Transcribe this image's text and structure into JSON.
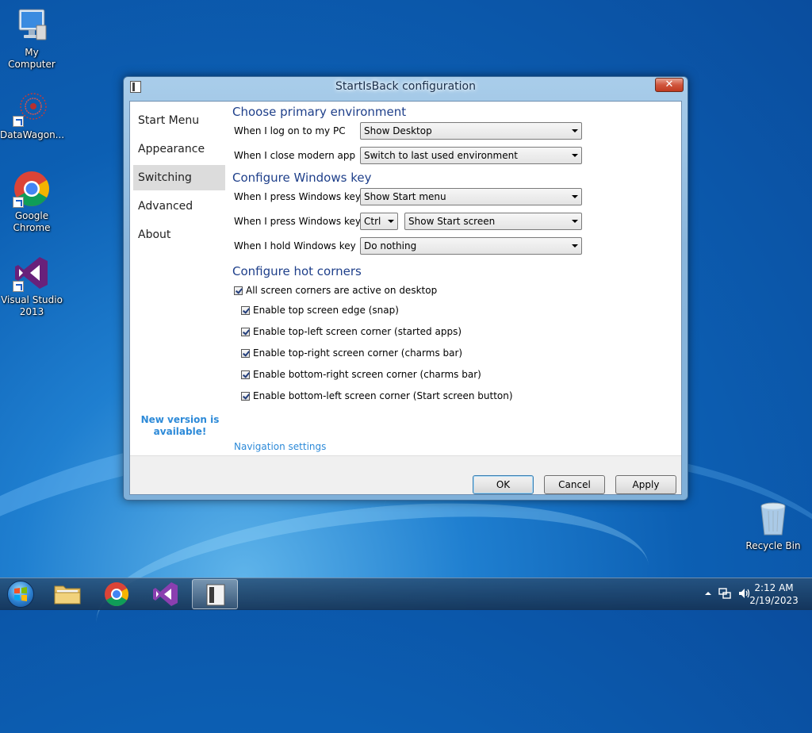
{
  "desktop": {
    "icons": [
      {
        "label": "My Computer"
      },
      {
        "label": "DataWagon..."
      },
      {
        "label_line1": "Google",
        "label_line2": "Chrome"
      },
      {
        "label_line1": "Visual Studio",
        "label_line2": "2013"
      }
    ],
    "recycle_bin": "Recycle Bin"
  },
  "dialog": {
    "title": "StartIsBack configuration",
    "close_glyph": "✕",
    "nav": [
      "Start Menu",
      "Appearance",
      "Switching",
      "Advanced",
      "About"
    ],
    "nav_selected": "Switching",
    "new_version_line1": "New version is",
    "new_version_line2": "available!",
    "sections": {
      "primary": "Choose primary environment",
      "winkey": "Configure Windows key",
      "hotcorners": "Configure hot corners"
    },
    "rows": {
      "logon_label": "When I log on to my PC",
      "logon_value": "Show Desktop",
      "close_label": "When I close modern app",
      "close_value": "Switch to last used environment",
      "press_label": "When I press Windows key",
      "press_value": "Show Start menu",
      "press_plus_label": "When I press Windows key +",
      "press_plus_mod": "Ctrl",
      "press_plus_value": "Show Start screen",
      "hold_label": "When I hold Windows key",
      "hold_value": "Do nothing"
    },
    "checkboxes": {
      "all_corners": "All screen corners are active on desktop",
      "top_edge": "Enable top screen edge (snap)",
      "top_left": "Enable top-left screen corner (started apps)",
      "top_right": "Enable top-right screen corner (charms bar)",
      "bottom_right": "Enable bottom-right screen corner (charms bar)",
      "bottom_left": "Enable bottom-left screen corner (Start screen button)"
    },
    "nav_settings_link": "Navigation settings",
    "buttons": {
      "ok": "OK",
      "cancel": "Cancel",
      "apply": "Apply"
    }
  },
  "taskbar": {
    "clock_time": "2:12 AM",
    "clock_date": "2/19/2023"
  },
  "colors": {
    "accent": "#1e3f8a",
    "link": "#2d8ad8"
  }
}
